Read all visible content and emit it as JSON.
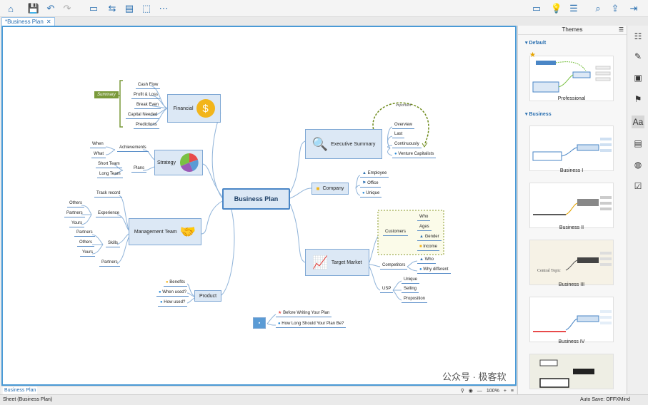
{
  "toolbar": {
    "icons": [
      "home-icon",
      "save-icon",
      "undo-icon",
      "redo-icon",
      "topic-icon",
      "relationship-icon",
      "summary-icon",
      "boundary-icon",
      "more-icon",
      "present-icon",
      "idea-icon",
      "outliner-icon",
      "search-icon",
      "share-icon",
      "export-icon"
    ]
  },
  "tab": {
    "title": "*Business Plan",
    "close": "✕"
  },
  "map": {
    "central": "Business Plan",
    "financial": {
      "label": "Financial",
      "children": [
        "Cash Flow",
        "Profit & Loss",
        "Break Even",
        "Capital Needed",
        "Predictions"
      ],
      "summary": "Summary"
    },
    "strategy": {
      "label": "Strategy",
      "achievements": "Achievements",
      "plans": "Plans",
      "when": "When",
      "what": "What",
      "short": "Short Team",
      "long": "Long Team"
    },
    "management": {
      "label": "Management Team",
      "track": "Track record",
      "experience": "Experience",
      "skills": "Skills",
      "partners": "Partners",
      "exp_children": [
        "Others",
        "Partners",
        "Yours"
      ],
      "skill_children": [
        "Partners",
        "Others",
        "Yours"
      ]
    },
    "product": {
      "label": "Product",
      "children": [
        "Benefits",
        "When used?",
        "How used?"
      ]
    },
    "executive": {
      "label": "Executive Summary",
      "children": [
        "Overview",
        "Last",
        "Continuously",
        "Venture Capitalists"
      ],
      "relationship": "Important"
    },
    "company": {
      "label": "Company",
      "children": [
        "Employee",
        "Office",
        "Unique"
      ]
    },
    "market": {
      "label": "Target Market",
      "customers": "Customers",
      "customer_children": [
        "Who",
        "Ages",
        "Gender",
        "Income"
      ],
      "competitors": "Competitors",
      "comp_children": [
        "Who",
        "Why different"
      ],
      "usp": "USP",
      "usp_children": [
        "Unique",
        "Selling",
        "Proposition"
      ]
    },
    "floating": [
      "Before Writing Your Plan",
      "How Long Should Your Plan Be?"
    ]
  },
  "sheet": {
    "tab": "Business Plan",
    "zoom": "100%",
    "minus": "—",
    "plus": "+"
  },
  "status": {
    "sheet": "Sheet (Business Plan)",
    "autosave": "Auto Save: OFF",
    "app": "XMind"
  },
  "panel": {
    "title": "Themes",
    "sections": [
      "Default",
      "Business"
    ],
    "themes": [
      "Professional",
      "Business I",
      "Business II",
      "Business III",
      "Business IV"
    ]
  },
  "watermark": "公众号 · 极客软件馆"
}
